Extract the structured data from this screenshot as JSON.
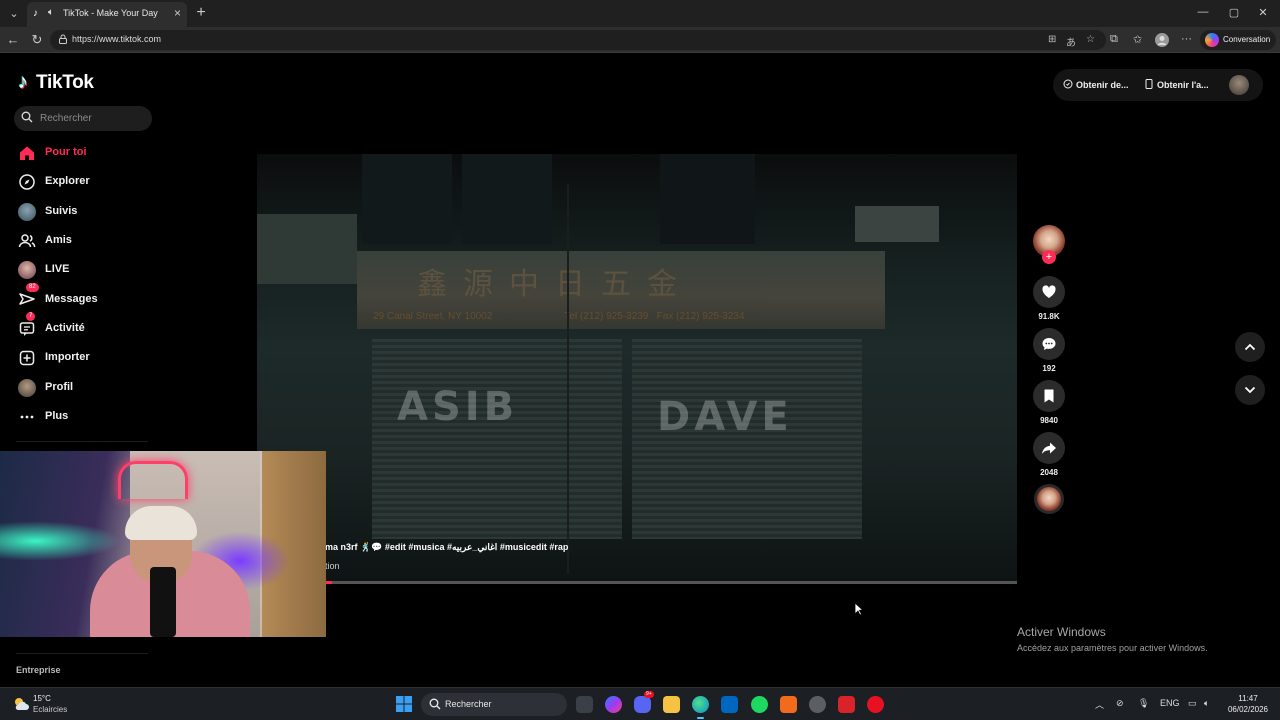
{
  "browser": {
    "tab_title": "TikTok - Make Your Day",
    "url": "https://www.tiktok.com",
    "copilot_label": "Conversation"
  },
  "tiktok": {
    "logo_text": "TikTok",
    "search_placeholder": "Rechercher",
    "nav": [
      {
        "label": "Pour toi",
        "icon": "home-icon",
        "active": true
      },
      {
        "label": "Explorer",
        "icon": "compass-icon"
      },
      {
        "label": "Suivis",
        "icon": "avatar"
      },
      {
        "label": "Amis",
        "icon": "friends-icon"
      },
      {
        "label": "LIVE",
        "icon": "avatar"
      },
      {
        "label": "Messages",
        "icon": "paper-plane-icon",
        "badge": "82"
      },
      {
        "label": "Activité",
        "icon": "inbox-icon",
        "badge": "7"
      },
      {
        "label": "Importer",
        "icon": "plus-square-icon"
      },
      {
        "label": "Profil",
        "icon": "avatar"
      },
      {
        "label": "Plus",
        "icon": "more-icon"
      }
    ],
    "footer_link": "Entreprise",
    "top_buttons": {
      "get_coins": "Obtenir de...",
      "get_app": "Obtenir l'a..."
    },
    "video": {
      "caption": "ma n3rf 🕺💬 #edit #musica #اغاني_عربيه #musicedit #rap",
      "subcaption": "tion",
      "progress": 0.0
    },
    "actions": {
      "likes": "91.8K",
      "comments": "192",
      "saves": "9840",
      "shares": "2048"
    }
  },
  "windows_activation": {
    "title": "Activer Windows",
    "subtitle": "Accédez aux paramètres pour activer Windows."
  },
  "taskbar": {
    "weather_temp": "15°C",
    "weather_cond": "Eclaircies",
    "search_placeholder": "Rechercher",
    "language": "ENG",
    "time": "11:47",
    "date": "06/02/2026",
    "discord_badge": "9+"
  },
  "colors": {
    "accent": "#fe2c55",
    "page_bg": "#000000",
    "taskbar_bg": "#1c1f24"
  }
}
